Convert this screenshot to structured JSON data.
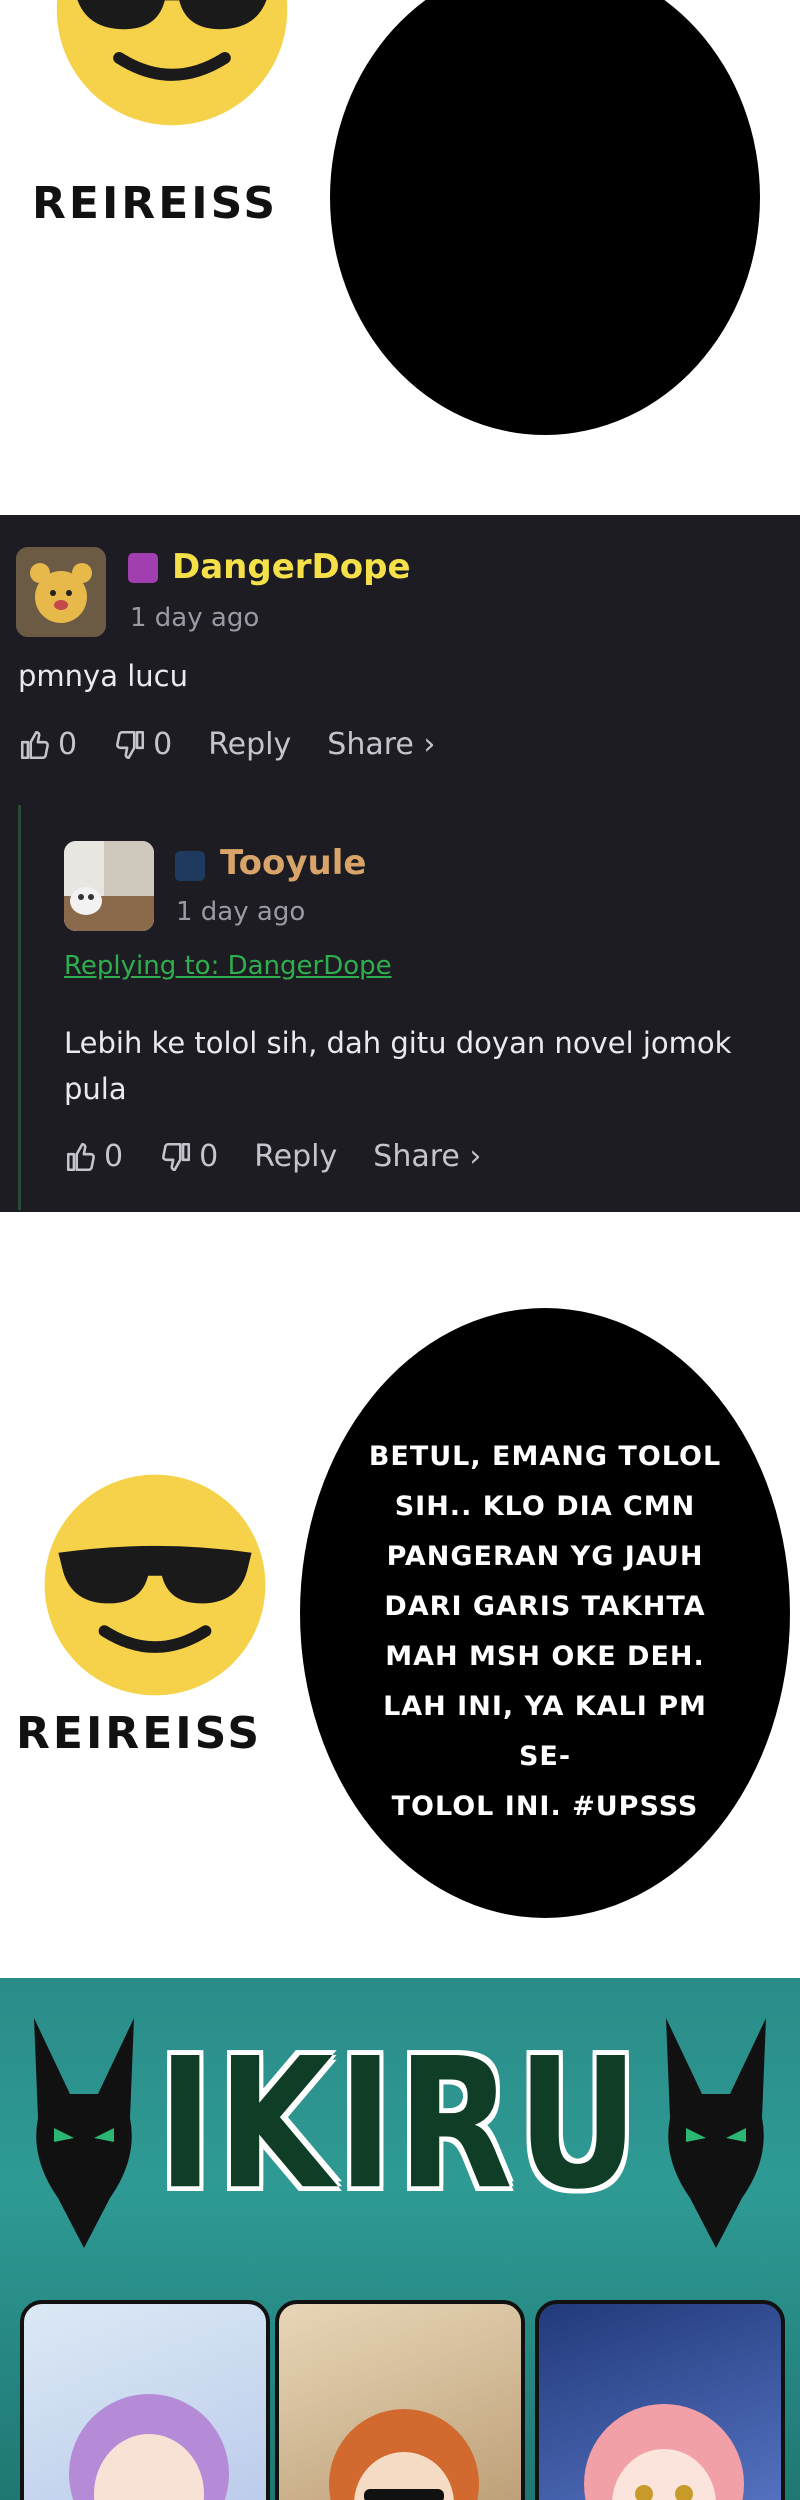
{
  "meme_top": {
    "name": "REIREISS"
  },
  "comments": [
    {
      "username": "DangerDope",
      "username_color": "#f5e04a",
      "time": "1 day ago",
      "text": "pmnya lucu",
      "likes": "0",
      "dislikes": "0",
      "reply_label": "Reply",
      "share_label": "Share ›"
    },
    {
      "username": "Tooyule",
      "username_color": "#d9a46a",
      "time": "1 day ago",
      "replying_to": "Replying to: DangerDope",
      "text": "Lebih ke tolol sih, dah gitu doyan novel jomok pula",
      "likes": "0",
      "dislikes": "0",
      "reply_label": "Reply",
      "share_label": "Share ›"
    }
  ],
  "meme_bottom": {
    "name": "REIREISS",
    "speech_lines": [
      "BETUL, EMANG TOLOL",
      "SIH.. KLO DIA CMN",
      "PANGERAN YG JAUH",
      "DARI GARIS TAKHTA",
      "MAH MSH OKE DEH.",
      "LAH INI, YA KALI PM SE-",
      "TOLOL INI. #UPSSS"
    ]
  },
  "promo": {
    "brand": "IKIRU"
  },
  "colors": {
    "comment_bg": "#1c1c22",
    "reply_link": "#2fae4e",
    "promo_bg": "#2a8c88"
  },
  "icons": [
    "sunglasses-emoji-icon",
    "thumbs-up-icon",
    "thumbs-down-icon",
    "jackal-logo-icon"
  ]
}
